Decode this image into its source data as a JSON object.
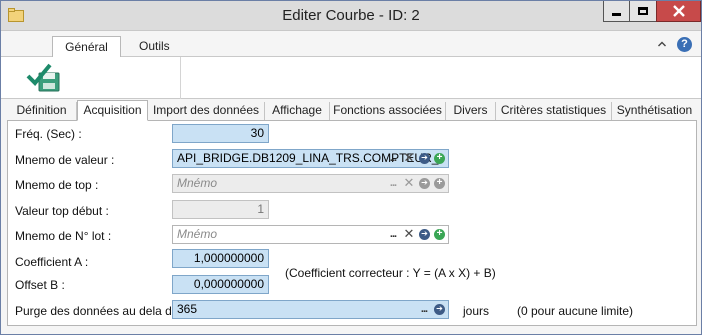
{
  "window": {
    "title": "Editer Courbe - ID: 2",
    "minimize_label": "",
    "maximize_label": "",
    "close_label": "X"
  },
  "ribbon": {
    "tabs": [
      {
        "label": "Général",
        "active": true
      },
      {
        "label": "Outils",
        "active": false
      }
    ],
    "help_label": "?"
  },
  "tabs": [
    {
      "label": "Définition",
      "active": false
    },
    {
      "label": "Acquisition",
      "active": true
    },
    {
      "label": "Import des données",
      "active": false
    },
    {
      "label": "Affichage",
      "active": false
    },
    {
      "label": "Fonctions associées",
      "active": false
    },
    {
      "label": "Divers",
      "active": false
    },
    {
      "label": "Critères statistiques",
      "active": false
    },
    {
      "label": "Synthétisation",
      "active": false
    }
  ],
  "form": {
    "freq": {
      "label": "Fréq. (Sec) :",
      "value": "30"
    },
    "mnemo_valeur": {
      "label": "Mnemo de valeur :",
      "value": "API_BRIDGE.DB1209_LINA_TRS.COMPTEUR_"
    },
    "mnemo_top": {
      "label": "Mnemo de top :",
      "placeholder": "Mnémo"
    },
    "valeur_top": {
      "label": "Valeur top début :",
      "value": "1"
    },
    "mnemo_lot": {
      "label": "Mnemo de N° lot :",
      "placeholder": "Mnémo"
    },
    "coef_a": {
      "label": "Coefficient A :",
      "value": "1,000000000"
    },
    "offset_b": {
      "label": "Offset B :",
      "value": "0,000000000"
    },
    "coef_note": "(Coefficient correcteur : Y = (A x X) + B)",
    "purge": {
      "label": "Purge des données au dela de :",
      "value": "365",
      "unit": "jours",
      "note": "(0 pour aucune limite)"
    }
  },
  "icons": {
    "dots": "...",
    "clear": "✕",
    "go": "➔",
    "add": "+"
  }
}
